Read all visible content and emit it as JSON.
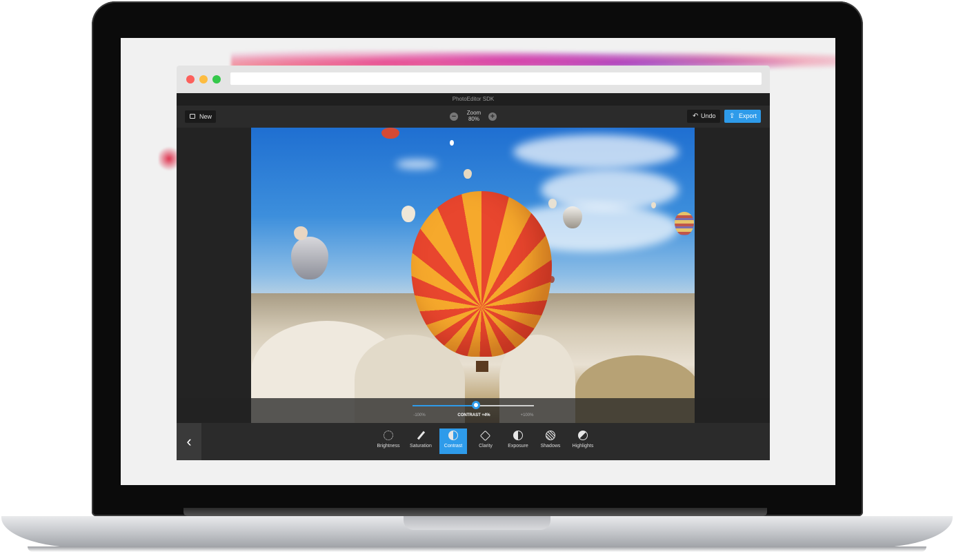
{
  "app": {
    "title": "PhotoEditor SDK"
  },
  "toolbar": {
    "new_label": "New",
    "zoom_label": "Zoom",
    "zoom_value": "80%",
    "zoom_minus": "−",
    "zoom_plus": "+",
    "undo_label": "Undo",
    "export_label": "Export"
  },
  "adjustment": {
    "min_label": "-100%",
    "current_label": "CONTRAST +4%",
    "max_label": "+100%",
    "value_percent": 4
  },
  "tools": [
    {
      "label": "Brightness",
      "icon": "brightness-icon"
    },
    {
      "label": "Saturation",
      "icon": "saturation-icon"
    },
    {
      "label": "Contrast",
      "icon": "contrast-icon",
      "active": true
    },
    {
      "label": "Clarity",
      "icon": "clarity-icon"
    },
    {
      "label": "Exposure",
      "icon": "exposure-icon"
    },
    {
      "label": "Shadows",
      "icon": "shadows-icon"
    },
    {
      "label": "Highlights",
      "icon": "highlights-icon"
    }
  ],
  "nav": {
    "back_glyph": "‹"
  },
  "colors": {
    "accent": "#2e9bea",
    "panel": "#2b2b2b",
    "dark": "#1a1a1a"
  }
}
